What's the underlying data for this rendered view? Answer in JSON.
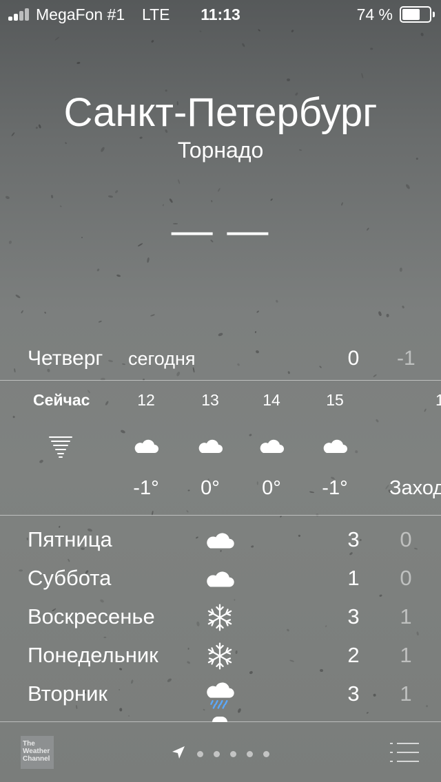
{
  "status_bar": {
    "carrier": "MegaFon #1",
    "network": "LTE",
    "time": "11:13",
    "battery_text": "74 %",
    "battery_level": 0.74
  },
  "header": {
    "city": "Санкт-Петербург",
    "condition": "Торнадо",
    "current_temp": "— —"
  },
  "today": {
    "day": "Четверг",
    "label": "сегодня",
    "high": "0",
    "low": "-1"
  },
  "hourly": [
    {
      "time": "Сейчас",
      "icon": "tornado-icon",
      "temp": ""
    },
    {
      "time": "12",
      "icon": "cloud-icon",
      "temp": "-1°"
    },
    {
      "time": "13",
      "icon": "cloud-icon",
      "temp": "0°"
    },
    {
      "time": "14",
      "icon": "cloud-icon",
      "temp": "0°"
    },
    {
      "time": "15",
      "icon": "cloud-icon",
      "temp": "-1°"
    },
    {
      "time": "1",
      "icon": "",
      "temp": "Заход"
    }
  ],
  "daily": [
    {
      "day": "Пятница",
      "icon": "cloud-icon",
      "high": "3",
      "low": "0"
    },
    {
      "day": "Суббота",
      "icon": "cloud-icon",
      "high": "1",
      "low": "0"
    },
    {
      "day": "Воскресенье",
      "icon": "snowflake-icon",
      "high": "3",
      "low": "1"
    },
    {
      "day": "Понедельник",
      "icon": "snowflake-icon",
      "high": "2",
      "low": "1"
    },
    {
      "day": "Вторник",
      "icon": "rain-cloud-icon",
      "high": "3",
      "low": "1"
    }
  ],
  "bottom_bar": {
    "provider_logo_text": "The Weather Channel",
    "page_dots": 5
  }
}
